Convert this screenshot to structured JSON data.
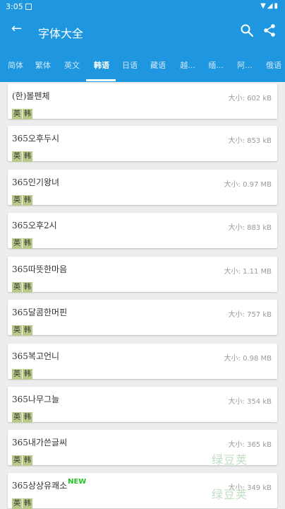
{
  "status": {
    "time": "3:05",
    "right_icons": "▼◢▮"
  },
  "appbar": {
    "title": "字体大全",
    "back_icon": "←"
  },
  "tabs": [
    "简体",
    "繁体",
    "英文",
    "韩语",
    "日语",
    "藏语",
    "越...",
    "缅...",
    "阿...",
    "俄语"
  ],
  "active_tab": "韩语",
  "size_label": "大小: ",
  "tag_labels": [
    "英",
    "韩"
  ],
  "fonts": [
    {
      "name": "(한)볼펜체",
      "size": "602 kB"
    },
    {
      "name": "365오후두시",
      "size": "853 kB"
    },
    {
      "name": "365인기왕녀",
      "size": "0.97 MB"
    },
    {
      "name": "365오후2시",
      "size": "883 kB"
    },
    {
      "name": "365따뜻한마음",
      "size": "1.11 MB"
    },
    {
      "name": "365달콤한머핀",
      "size": "757 kB"
    },
    {
      "name": "365복고언니",
      "size": "0.98 MB"
    },
    {
      "name": "365나무그늘",
      "size": "354 kB"
    },
    {
      "name": "365내가쓴글씨",
      "size": "365 kB"
    },
    {
      "name": "365상상유쾌소",
      "size": "349 kB",
      "badge": "NEW"
    }
  ],
  "watermarks": [
    "绿豆荚",
    "绿豆荚"
  ],
  "colors": {
    "primary": "#1e96e0",
    "tag_bg": "#b9c989",
    "new_badge": "#22c322"
  }
}
